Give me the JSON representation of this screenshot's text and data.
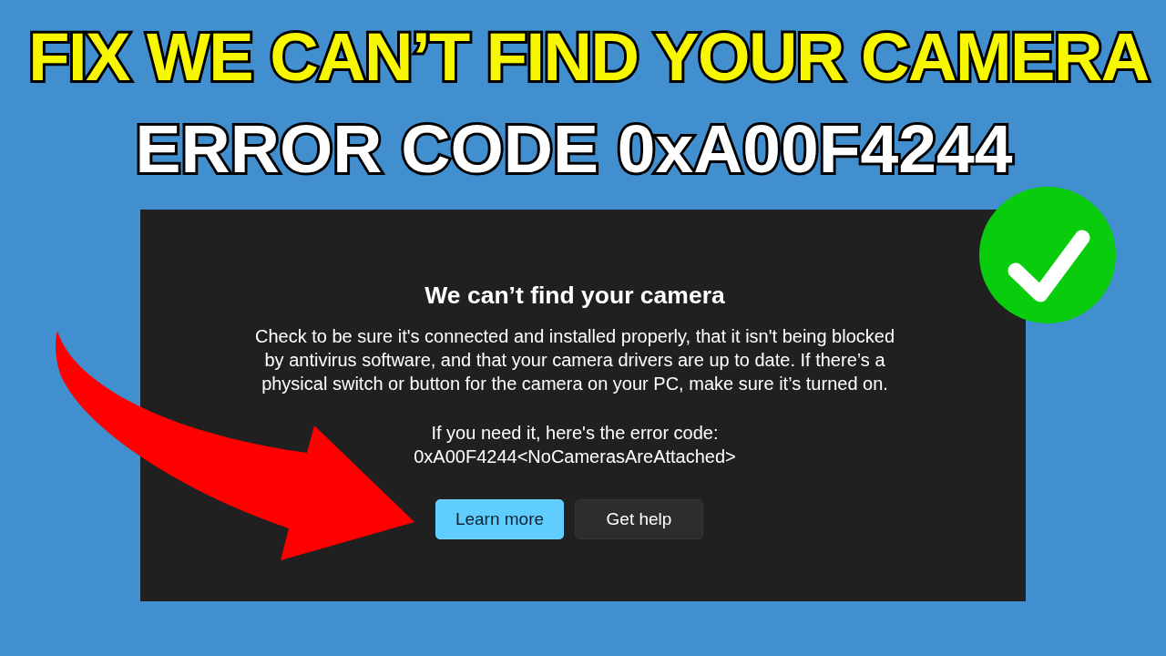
{
  "headline": {
    "lines": [
      {
        "text": "FIX WE CAN’T FIND YOUR CAMERA",
        "kind": "accent"
      },
      {
        "text": "ERROR CODE 0xA00F4244",
        "kind": "plain"
      }
    ]
  },
  "dialog": {
    "title": "We can’t find your camera",
    "message": "Check to be sure it's connected and installed properly, that it isn't being blocked by antivirus software, and that your camera drivers are up to date. If there’s a physical switch or button for the camera on your PC, make sure it’s turned on.",
    "error_label": "If you need it, here's the error code:",
    "error_code": "0xA00F4244<NoCamerasAreAttached>",
    "buttons": [
      {
        "label": "Learn more",
        "kind": "primary"
      },
      {
        "label": "Get help",
        "kind": "secondary"
      }
    ]
  }
}
